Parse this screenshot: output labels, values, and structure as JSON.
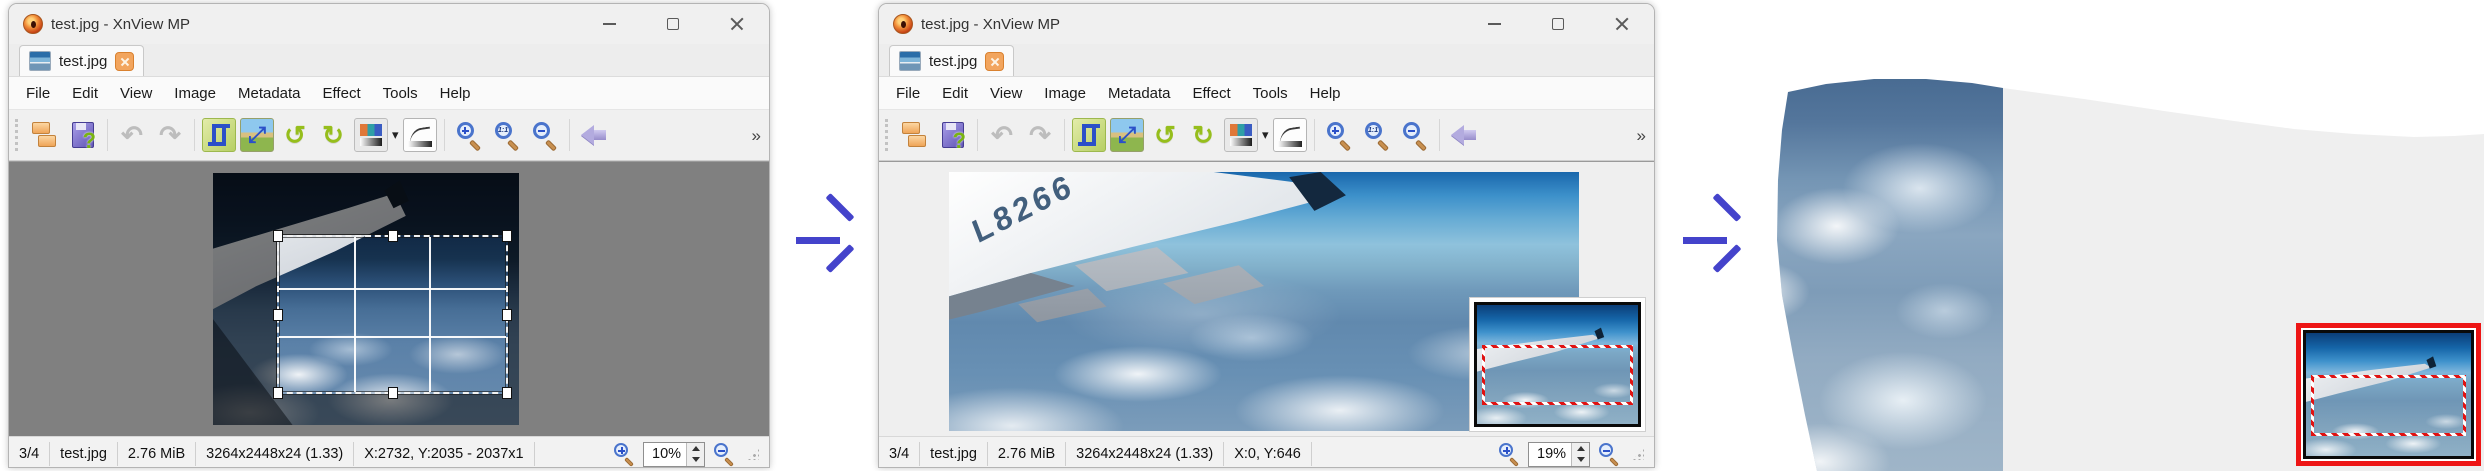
{
  "menu": [
    "File",
    "Edit",
    "View",
    "Image",
    "Metadata",
    "Effect",
    "Tools",
    "Help"
  ],
  "window1": {
    "title": "test.jpg - XnView MP",
    "tab_label": "test.jpg",
    "status": {
      "index": "3/4",
      "filename": "test.jpg",
      "filesize": "2.76 MiB",
      "dimensions": "3264x2448x24 (1.33)",
      "position": "X:2732, Y:2035 - 2037x1",
      "zoom": "10%"
    }
  },
  "window2": {
    "title": "test.jpg - XnView MP",
    "tab_label": "test.jpg",
    "status": {
      "index": "3/4",
      "filename": "test.jpg",
      "filesize": "2.76 MiB",
      "dimensions": "3264x2448x24 (1.33)",
      "position": "X:0, Y:646",
      "zoom": "19%"
    }
  },
  "photo": {
    "registration": "L8266"
  },
  "icons": {
    "undo": "↶",
    "redo": "↷",
    "resize": "⤢",
    "rotate_left": "↺",
    "rotate_right": "↻",
    "save_question": "?",
    "dropdown": "▾",
    "zoom_actual": "1:1",
    "overflow": "»"
  },
  "colors": {
    "arrow_accent": "#4443cb",
    "highlight_red": "#ed1515",
    "tab_close_orange": "#f2a55e",
    "canvas_gray": "#808080",
    "canvas_light": "#efefef",
    "selection_ants": "#f2f2f2",
    "navigator_ants_red": "#e01212"
  }
}
